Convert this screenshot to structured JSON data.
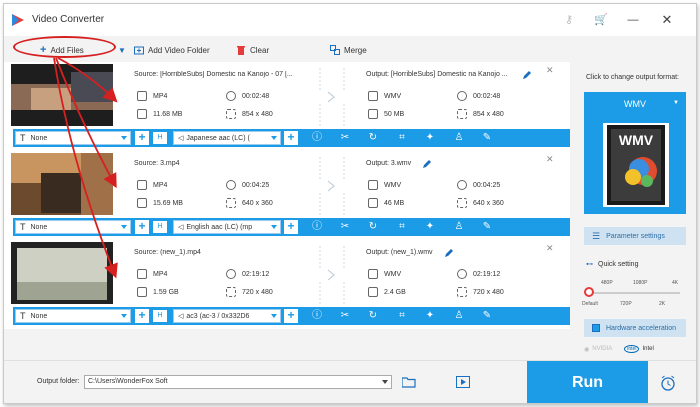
{
  "app": {
    "title": "Video Converter"
  },
  "toolbar": {
    "add_files": "Add Files",
    "add_video_folder": "Add Video Folder",
    "clear": "Clear",
    "merge": "Merge"
  },
  "items": [
    {
      "source": "Source: [HorribleSubs] Domestic na Kanojo - 07 [...",
      "output": "Output: [HorribleSubs] Domestic na Kanojo ...",
      "src_format": "MP4",
      "src_duration": "00:02:48",
      "src_size": "11.68 MB",
      "src_res": "854 x 480",
      "out_format": "WMV",
      "out_duration": "00:02:48",
      "out_size": "50 MB",
      "out_res": "854 x 480",
      "subtitle": "None",
      "audio": "Japanese aac (LC) ("
    },
    {
      "source": "Source: 3.mp4",
      "output": "Output: 3.wmv",
      "src_format": "MP4",
      "src_duration": "00:04:25",
      "src_size": "15.69 MB",
      "src_res": "640 x 360",
      "out_format": "WMV",
      "out_duration": "00:04:25",
      "out_size": "46 MB",
      "out_res": "640 x 360",
      "subtitle": "None",
      "audio": "English aac (LC) (mp"
    },
    {
      "source": "Source: (new_1).mp4",
      "output": "Output: (new_1).wmv",
      "src_format": "MP4",
      "src_duration": "02:19:12",
      "src_size": "1.59 GB",
      "src_res": "720 x 480",
      "out_format": "WMV",
      "out_duration": "02:19:12",
      "out_size": "2.4 GB",
      "out_res": "720 x 480",
      "subtitle": "None",
      "audio": "ac3 (ac-3 / 0x332D6"
    }
  ],
  "right_panel": {
    "click_label": "Click to change output format:",
    "format": "WMV",
    "format_logo_text": "WMV",
    "parameter_settings": "Parameter settings",
    "quick_setting": "Quick setting",
    "quality_top": [
      "480P",
      "1080P",
      "4K"
    ],
    "quality_bottom": [
      "Default",
      "720P",
      "2K"
    ],
    "hardware_acceleration": "Hardware acceleration",
    "gpu_nvidia": "NVIDIA",
    "gpu_intel": "Intel",
    "intel_logo_text": "intel"
  },
  "bottom": {
    "output_folder_label": "Output folder:",
    "output_folder_value": "C:\\Users\\WonderFox Soft",
    "run": "Run"
  },
  "colors": {
    "accent": "#1c9be6",
    "annotation": "#d62020"
  }
}
